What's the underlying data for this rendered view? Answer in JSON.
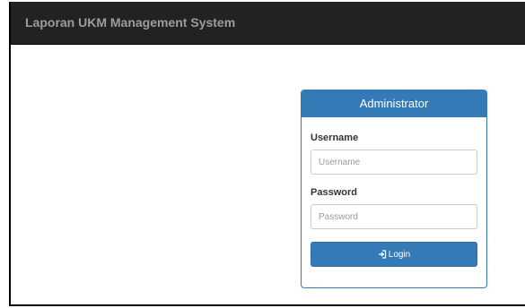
{
  "navbar": {
    "brand": "Laporan UKM Management System"
  },
  "panel": {
    "title": "Administrator",
    "username_label": "Username",
    "username_placeholder": "Username",
    "username_value": "",
    "password_label": "Password",
    "password_placeholder": "Password",
    "password_value": "",
    "login_label": "Login",
    "login_icon": "sign-in-icon"
  },
  "colors": {
    "navbar_bg": "#222222",
    "brand_text": "#9d9d9d",
    "primary": "#337ab7"
  }
}
